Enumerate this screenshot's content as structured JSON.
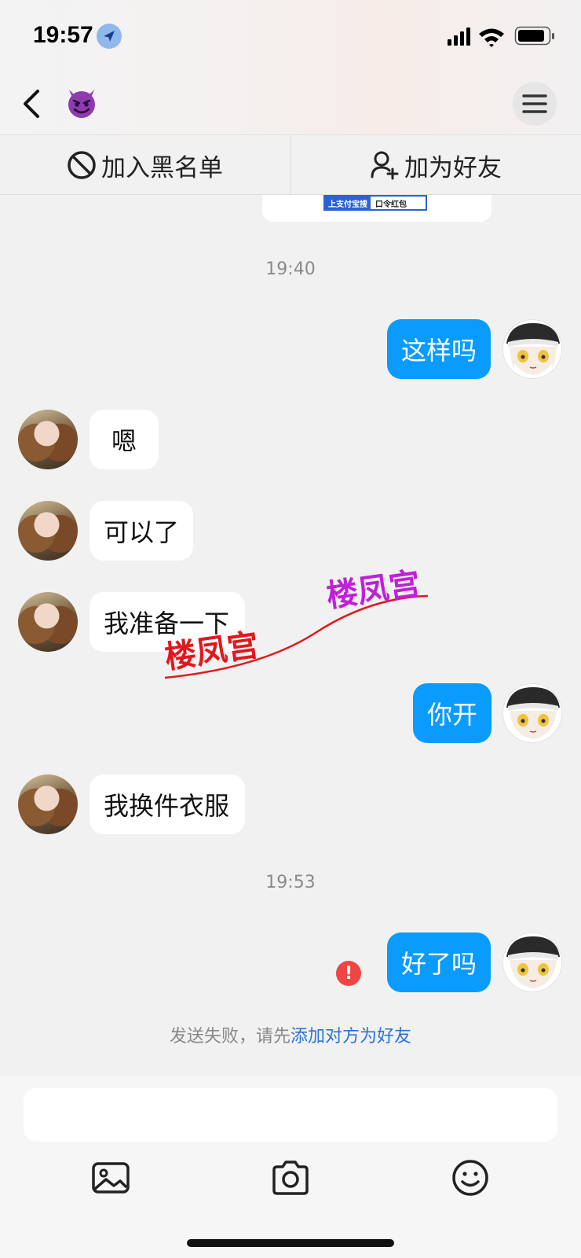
{
  "status_bar": {
    "time": "19:57"
  },
  "header": {
    "contact_emoji": "😈"
  },
  "actions": {
    "block_label": "加入黑名单",
    "add_friend_label": "加为好友"
  },
  "card": {
    "tag_blue": "上支付宝搜",
    "tag_text": "口令红包"
  },
  "messages": [
    {
      "type": "time",
      "text": "19:40"
    },
    {
      "type": "out",
      "text": "这样吗"
    },
    {
      "type": "in",
      "text": "嗯"
    },
    {
      "type": "in",
      "text": "可以了"
    },
    {
      "type": "in",
      "text": "我准备一下"
    },
    {
      "type": "out",
      "text": "你开"
    },
    {
      "type": "in",
      "text": "我换件衣服"
    },
    {
      "type": "time",
      "text": "19:53"
    },
    {
      "type": "out",
      "text": "好了吗",
      "failed": true
    }
  ],
  "error": {
    "icon_text": "!",
    "note_prefix": "发送失败，请先",
    "note_link": "添加对方为好友"
  },
  "watermark": {
    "text": "楼凤宫"
  },
  "colors": {
    "out_bubble": "#0a9bff",
    "link": "#2a73d9",
    "error": "#f04545"
  },
  "toolbar": {
    "icons": [
      "image-icon",
      "camera-icon",
      "emoji-icon"
    ]
  }
}
